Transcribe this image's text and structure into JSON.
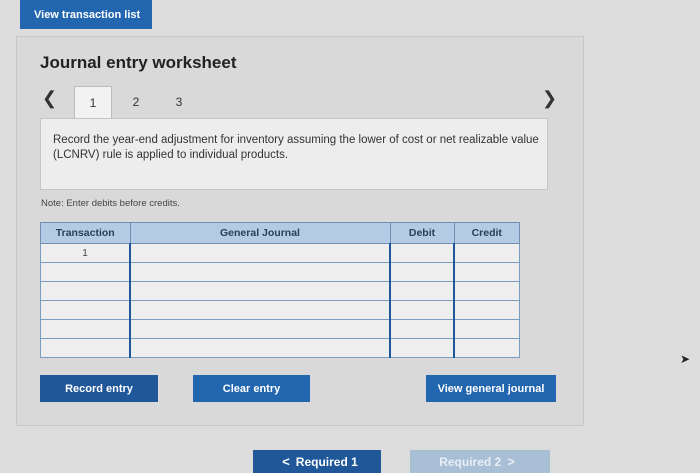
{
  "top": {
    "view_transaction_list": "View transaction list"
  },
  "worksheet": {
    "title": "Journal entry worksheet",
    "tabs": [
      "1",
      "2",
      "3"
    ],
    "active_tab": "1",
    "instructions": "Record the year-end adjustment for inventory assuming the lower of cost or net realizable value (LCNRV) rule is applied to individual products.",
    "note": "Note: Enter debits before credits."
  },
  "table": {
    "headers": [
      "Transaction",
      "General Journal",
      "Debit",
      "Credit"
    ],
    "rows": [
      {
        "transaction": "1",
        "account": "",
        "debit": "",
        "credit": ""
      },
      {
        "transaction": "",
        "account": "",
        "debit": "",
        "credit": ""
      },
      {
        "transaction": "",
        "account": "",
        "debit": "",
        "credit": ""
      },
      {
        "transaction": "",
        "account": "",
        "debit": "",
        "credit": ""
      },
      {
        "transaction": "",
        "account": "",
        "debit": "",
        "credit": ""
      },
      {
        "transaction": "",
        "account": "",
        "debit": "",
        "credit": ""
      }
    ]
  },
  "buttons": {
    "record_entry": "Record entry",
    "clear_entry": "Clear entry",
    "view_general_journal": "View general journal"
  },
  "nav": {
    "prev_label": "Required 1",
    "next_label": "Required 2"
  }
}
